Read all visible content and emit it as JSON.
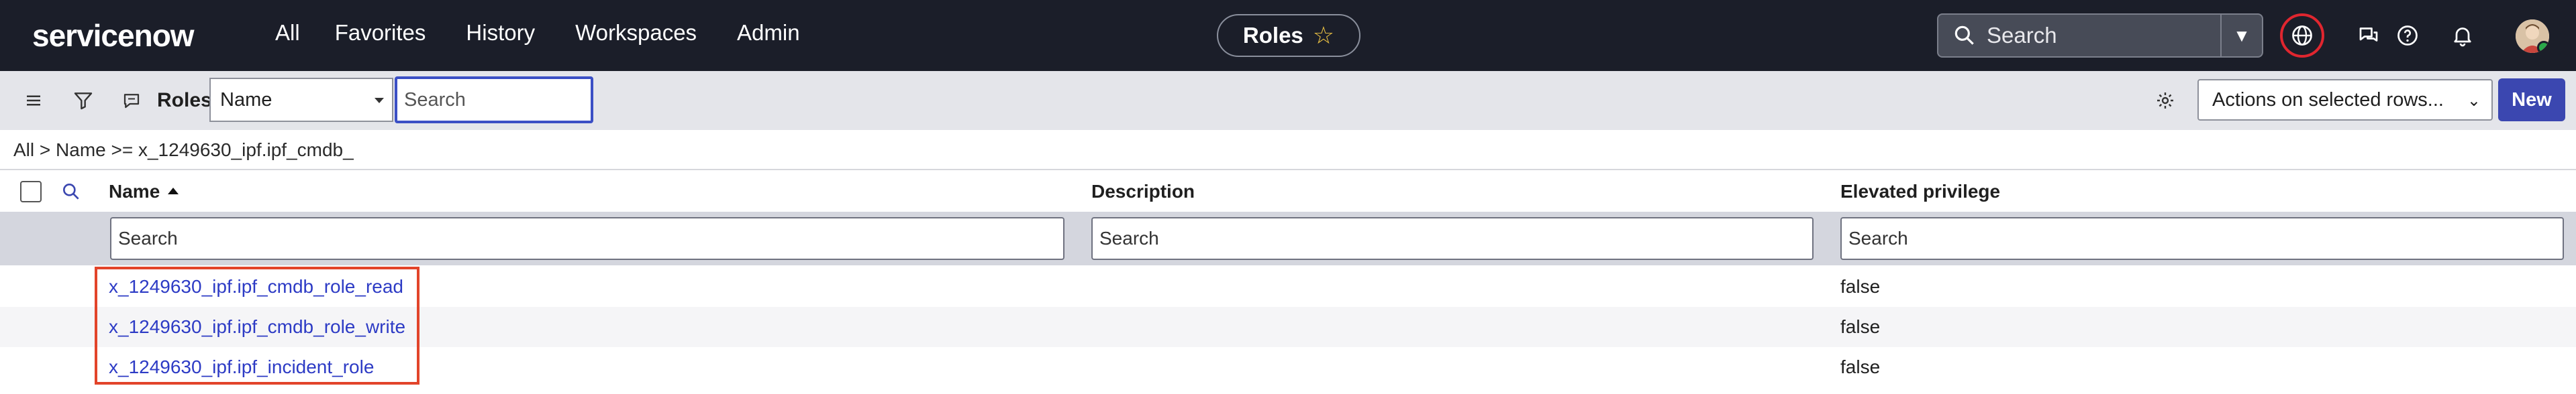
{
  "topnav": {
    "logo": "servicenow",
    "items": [
      "All",
      "Favorites",
      "History",
      "Workspaces",
      "Admin"
    ],
    "context_title": "Roles",
    "search_placeholder": "Search"
  },
  "toolbar": {
    "title": "Roles",
    "field_select": "Name",
    "search_placeholder": "Search",
    "actions_label": "Actions on selected rows...",
    "new_label": "New"
  },
  "breadcrumb": "All > Name >= x_1249630_ipf.ipf_cmdb_",
  "table": {
    "columns": [
      "Name",
      "Description",
      "Elevated privilege"
    ],
    "filter_placeholder": "Search",
    "rows": [
      {
        "name": "x_1249630_ipf.ipf_cmdb_role_read",
        "description": "",
        "elevated": "false"
      },
      {
        "name": "x_1249630_ipf.ipf_cmdb_role_write",
        "description": "",
        "elevated": "false"
      },
      {
        "name": "x_1249630_ipf.ipf_incident_role",
        "description": "",
        "elevated": "false"
      }
    ]
  },
  "colors": {
    "nav_bg": "#1b1e29",
    "accent": "#3b47b0",
    "link": "#2d3bc5",
    "highlight": "#e2442a",
    "globe_ring": "#e0262f"
  },
  "icons": [
    "search-icon",
    "star-icon",
    "chevron-down-icon",
    "globe-icon",
    "chat-icon",
    "help-icon",
    "bell-icon",
    "menu-icon",
    "filter-icon",
    "comment-icon",
    "gear-icon"
  ]
}
